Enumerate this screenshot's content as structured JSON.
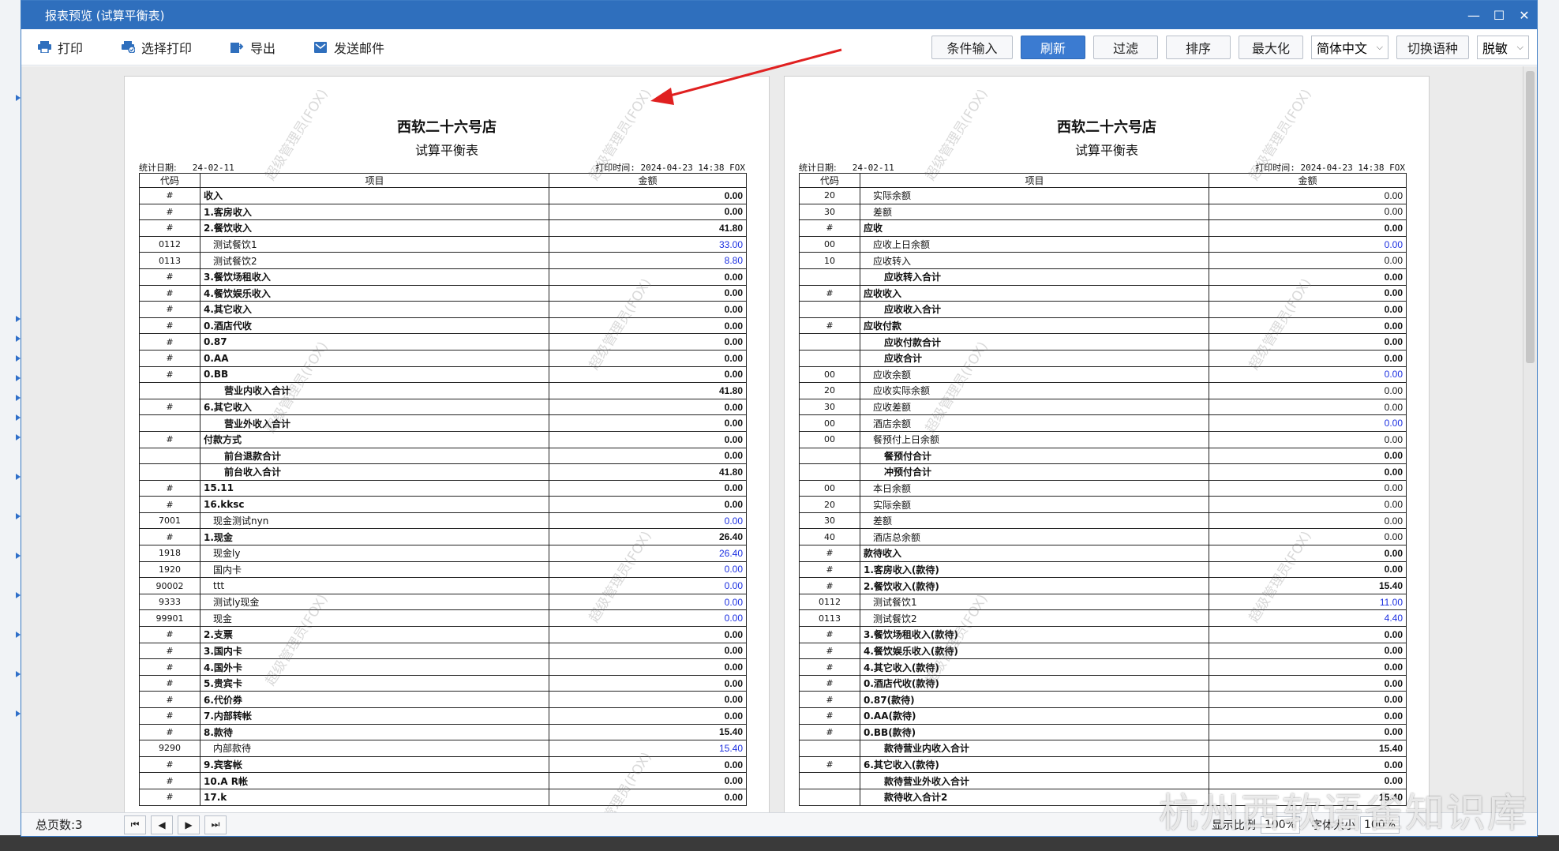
{
  "window": {
    "title": "报表预览 (试算平衡表)"
  },
  "toolbar": {
    "print": "打印",
    "select_print": "选择打印",
    "export": "导出",
    "send_mail": "发送邮件",
    "condition_input": "条件输入",
    "refresh": "刷新",
    "filter": "过滤",
    "sort": "排序",
    "maximize": "最大化",
    "language_value": "简体中文",
    "switch_language": "切换语种",
    "desensitize_value": "脱敏"
  },
  "page_left": {
    "store": "西软二十六号店",
    "report_title": "试算平衡表",
    "stat_date_label": "统计日期:",
    "stat_date": "24-02-11",
    "print_time": "打印时间: 2024-04-23 14:38 FOX",
    "headers": [
      "代码",
      "项目",
      "金额"
    ],
    "rows": [
      {
        "code": "#",
        "item": "收入",
        "amount": "0.00",
        "bold": true
      },
      {
        "code": "#",
        "item": "1.客房收入",
        "amount": "0.00",
        "bold": true
      },
      {
        "code": "#",
        "item": "2.餐饮收入",
        "amount": "41.80",
        "bold": true
      },
      {
        "code": "0112",
        "item": "测试餐饮1",
        "amount": "33.00",
        "indent": 1,
        "blue": true
      },
      {
        "code": "0113",
        "item": "测试餐饮2",
        "amount": "8.80",
        "indent": 1,
        "blue": true
      },
      {
        "code": "#",
        "item": "3.餐饮场租收入",
        "amount": "0.00",
        "bold": true
      },
      {
        "code": "#",
        "item": "4.餐饮娱乐收入",
        "amount": "0.00",
        "bold": true
      },
      {
        "code": "#",
        "item": "4.其它收入",
        "amount": "0.00",
        "bold": true
      },
      {
        "code": "#",
        "item": "0.酒店代收",
        "amount": "0.00",
        "bold": true
      },
      {
        "code": "#",
        "item": "0.87",
        "amount": "0.00",
        "bold": true
      },
      {
        "code": "#",
        "item": "0.AA",
        "amount": "0.00",
        "bold": true
      },
      {
        "code": "#",
        "item": "0.BB",
        "amount": "0.00",
        "bold": true
      },
      {
        "code": "",
        "item": "营业内收入合计",
        "amount": "41.80",
        "bold": true,
        "indent": 2
      },
      {
        "code": "#",
        "item": "6.其它收入",
        "amount": "0.00",
        "bold": true
      },
      {
        "code": "",
        "item": "营业外收入合计",
        "amount": "0.00",
        "bold": true,
        "indent": 2
      },
      {
        "code": "#",
        "item": "付款方式",
        "amount": "0.00",
        "bold": true
      },
      {
        "code": "",
        "item": "前台退款合计",
        "amount": "0.00",
        "bold": true,
        "indent": 2
      },
      {
        "code": "",
        "item": "前台收入合计",
        "amount": "41.80",
        "bold": true,
        "indent": 2
      },
      {
        "code": "#",
        "item": "15.11",
        "amount": "0.00",
        "bold": true
      },
      {
        "code": "#",
        "item": "16.kksc",
        "amount": "0.00",
        "bold": true
      },
      {
        "code": "7001",
        "item": "现金测试nyn",
        "amount": "0.00",
        "indent": 1,
        "blue": true
      },
      {
        "code": "#",
        "item": "1.现金",
        "amount": "26.40",
        "bold": true
      },
      {
        "code": "1918",
        "item": "现金ly",
        "amount": "26.40",
        "indent": 1,
        "blue": true
      },
      {
        "code": "1920",
        "item": "国内卡",
        "amount": "0.00",
        "indent": 1,
        "blue": true
      },
      {
        "code": "90002",
        "item": "ttt",
        "amount": "0.00",
        "indent": 1,
        "blue": true
      },
      {
        "code": "9333",
        "item": "测试ly现金",
        "amount": "0.00",
        "indent": 1,
        "blue": true
      },
      {
        "code": "99901",
        "item": "现金",
        "amount": "0.00",
        "indent": 1,
        "blue": true
      },
      {
        "code": "#",
        "item": "2.支票",
        "amount": "0.00",
        "bold": true
      },
      {
        "code": "#",
        "item": "3.国内卡",
        "amount": "0.00",
        "bold": true
      },
      {
        "code": "#",
        "item": "4.国外卡",
        "amount": "0.00",
        "bold": true
      },
      {
        "code": "#",
        "item": "5.贵宾卡",
        "amount": "0.00",
        "bold": true
      },
      {
        "code": "#",
        "item": "6.代价券",
        "amount": "0.00",
        "bold": true
      },
      {
        "code": "#",
        "item": "7.内部转帐",
        "amount": "0.00",
        "bold": true
      },
      {
        "code": "#",
        "item": "8.款待",
        "amount": "15.40",
        "bold": true
      },
      {
        "code": "9290",
        "item": "内部款待",
        "amount": "15.40",
        "indent": 1,
        "blue": true
      },
      {
        "code": "#",
        "item": "9.宾客帐",
        "amount": "0.00",
        "bold": true
      },
      {
        "code": "#",
        "item": "10.A R帐",
        "amount": "0.00",
        "bold": true
      },
      {
        "code": "#",
        "item": "17.k",
        "amount": "0.00",
        "bold": true
      }
    ]
  },
  "page_right": {
    "store": "西软二十六号店",
    "report_title": "试算平衡表",
    "stat_date_label": "统计日期:",
    "stat_date": "24-02-11",
    "print_time": "打印时间: 2024-04-23 14:38 FOX",
    "headers": [
      "代码",
      "项目",
      "金额"
    ],
    "rows": [
      {
        "code": "20",
        "item": "实际余额",
        "amount": "0.00",
        "indent": 1
      },
      {
        "code": "30",
        "item": "差额",
        "amount": "0.00",
        "indent": 1
      },
      {
        "code": "#",
        "item": "应收",
        "amount": "0.00",
        "bold": true
      },
      {
        "code": "00",
        "item": "应收上日余额",
        "amount": "0.00",
        "indent": 1,
        "blue": true
      },
      {
        "code": "10",
        "item": "应收转入",
        "amount": "0.00",
        "indent": 1
      },
      {
        "code": "",
        "item": "应收转入合计",
        "amount": "0.00",
        "bold": true,
        "indent": 2
      },
      {
        "code": "#",
        "item": "应收收入",
        "amount": "0.00",
        "bold": true
      },
      {
        "code": "",
        "item": "应收收入合计",
        "amount": "0.00",
        "bold": true,
        "indent": 2
      },
      {
        "code": "#",
        "item": "应收付款",
        "amount": "0.00",
        "bold": true
      },
      {
        "code": "",
        "item": "应收付款合计",
        "amount": "0.00",
        "bold": true,
        "indent": 2
      },
      {
        "code": "",
        "item": "应收合计",
        "amount": "0.00",
        "bold": true,
        "indent": 2
      },
      {
        "code": "00",
        "item": "应收余额",
        "amount": "0.00",
        "indent": 1,
        "blue": true
      },
      {
        "code": "20",
        "item": "应收实际余额",
        "amount": "0.00",
        "indent": 1
      },
      {
        "code": "30",
        "item": "应收差额",
        "amount": "0.00",
        "indent": 1
      },
      {
        "code": "00",
        "item": "酒店余额",
        "amount": "0.00",
        "indent": 1,
        "blue": true
      },
      {
        "code": "00",
        "item": "餐预付上日余额",
        "amount": "0.00",
        "indent": 1
      },
      {
        "code": "",
        "item": "餐预付合计",
        "amount": "0.00",
        "bold": true,
        "indent": 2
      },
      {
        "code": "",
        "item": "冲预付合计",
        "amount": "0.00",
        "bold": true,
        "indent": 2
      },
      {
        "code": "00",
        "item": "本日余额",
        "amount": "0.00",
        "indent": 1
      },
      {
        "code": "20",
        "item": "实际余额",
        "amount": "0.00",
        "indent": 1
      },
      {
        "code": "30",
        "item": "差额",
        "amount": "0.00",
        "indent": 1
      },
      {
        "code": "40",
        "item": "酒店总余额",
        "amount": "0.00",
        "indent": 1
      },
      {
        "code": "#",
        "item": "款待收入",
        "amount": "0.00",
        "bold": true
      },
      {
        "code": "#",
        "item": "1.客房收入(款待)",
        "amount": "0.00",
        "bold": true
      },
      {
        "code": "#",
        "item": "2.餐饮收入(款待)",
        "amount": "15.40",
        "bold": true
      },
      {
        "code": "0112",
        "item": "测试餐饮1",
        "amount": "11.00",
        "indent": 1,
        "blue": true
      },
      {
        "code": "0113",
        "item": "测试餐饮2",
        "amount": "4.40",
        "indent": 1,
        "blue": true
      },
      {
        "code": "#",
        "item": "3.餐饮场租收入(款待)",
        "amount": "0.00",
        "bold": true
      },
      {
        "code": "#",
        "item": "4.餐饮娱乐收入(款待)",
        "amount": "0.00",
        "bold": true
      },
      {
        "code": "#",
        "item": "4.其它收入(款待)",
        "amount": "0.00",
        "bold": true
      },
      {
        "code": "#",
        "item": "0.酒店代收(款待)",
        "amount": "0.00",
        "bold": true
      },
      {
        "code": "#",
        "item": "0.87(款待)",
        "amount": "0.00",
        "bold": true
      },
      {
        "code": "#",
        "item": "0.AA(款待)",
        "amount": "0.00",
        "bold": true
      },
      {
        "code": "#",
        "item": "0.BB(款待)",
        "amount": "0.00",
        "bold": true
      },
      {
        "code": "",
        "item": "款待营业内收入合计",
        "amount": "15.40",
        "bold": true,
        "indent": 2
      },
      {
        "code": "#",
        "item": "6.其它收入(款待)",
        "amount": "0.00",
        "bold": true
      },
      {
        "code": "",
        "item": "款待营业外收入合计",
        "amount": "0.00",
        "bold": true,
        "indent": 2
      },
      {
        "code": "",
        "item": "款待收入合计2",
        "amount": "15.40",
        "bold": true,
        "indent": 2
      }
    ]
  },
  "watermark": "超级管理员(FOX)",
  "statusbar": {
    "total_pages": "总页数:3",
    "display_ratio_label": "显示比例",
    "display_ratio": "100%",
    "font_size_label": "字体大小",
    "font_size": "100%"
  },
  "overlay_brand": "杭州西软语雀知识库",
  "colors": {
    "titlebar": "#2f6fbd",
    "active_button": "#3b7bd1",
    "detail_amount": "#1a2ee0",
    "annotation_arrow": "#e02020"
  },
  "icons": [
    "printer-icon",
    "select-print-icon",
    "export-icon",
    "mail-icon",
    "first-page-icon",
    "prev-page-icon",
    "next-page-icon",
    "last-page-icon",
    "minimize-icon",
    "maximize-icon",
    "close-icon"
  ]
}
